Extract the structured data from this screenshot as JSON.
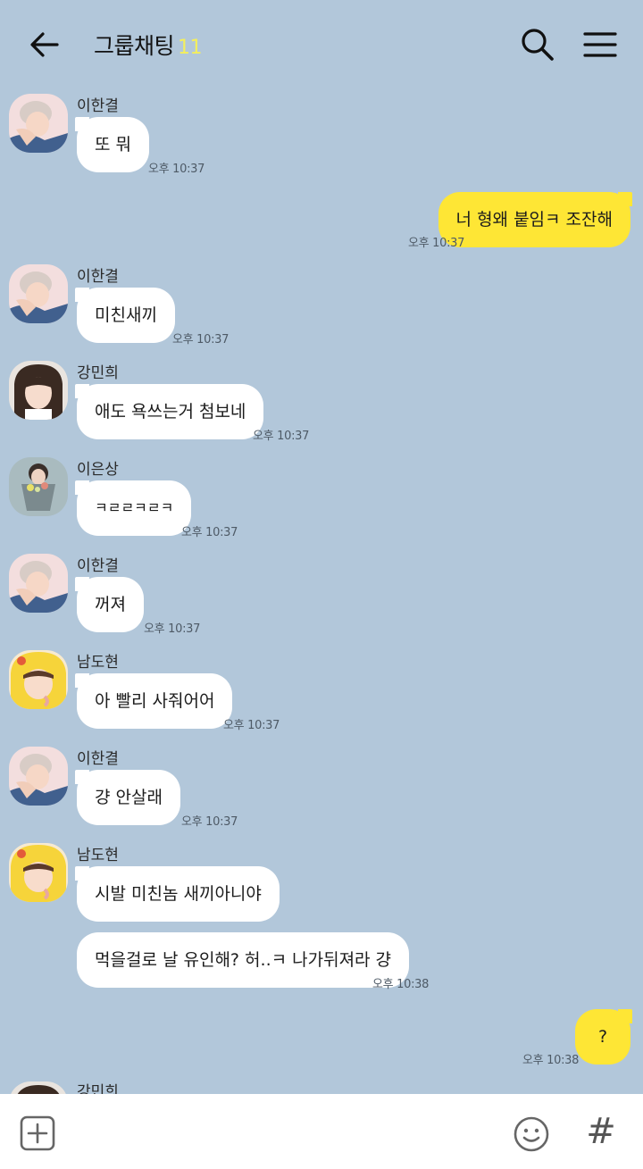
{
  "header": {
    "title": "그룹채팅",
    "member_count": "11"
  },
  "messages": [
    {
      "sender": "이한결",
      "text": "또 뭐",
      "time": "오후 10:37"
    },
    {
      "text": "너 형왜 붙임ㅋ 조잔해",
      "time": "오후 10:37"
    },
    {
      "sender": "이한결",
      "text": "미친새끼",
      "time": "오후 10:37"
    },
    {
      "sender": "강민희",
      "text": "애도 욕쓰는거 첨보네",
      "time": "오후 10:37"
    },
    {
      "sender": "이은상",
      "text": "ㅋㄹㄹㅋㄹㅋ",
      "time": "오후 10:37"
    },
    {
      "sender": "이한결",
      "text": "꺼져",
      "time": "오후 10:37"
    },
    {
      "sender": "남도현",
      "text": "아 빨리 사줘어어",
      "time": "오후 10:37"
    },
    {
      "sender": "이한결",
      "text": "걍 안살래",
      "time": "오후 10:37"
    },
    {
      "sender": "남도현",
      "text": "시발 미친놈 새끼아니야"
    },
    {
      "text": "먹을걸로 날 유인해? 허..ㅋ 나가뒤져라 걍",
      "time": "오후 10:38"
    },
    {
      "text": "?",
      "time": "오후 10:38"
    },
    {
      "sender": "강민희"
    }
  ],
  "icons": {
    "back": "arrow-left-icon",
    "search": "search-icon",
    "menu": "hamburger-menu-icon",
    "add": "plus-square-icon",
    "emoji": "smiley-icon",
    "hashtag": "hashtag-icon"
  },
  "bottom_bar": {
    "hashtag_glyph": "#"
  },
  "colors": {
    "background": "#b2c7da",
    "incoming_bubble": "#ffffff",
    "outgoing_bubble": "#fee635",
    "member_count": "#f4ef5c"
  }
}
